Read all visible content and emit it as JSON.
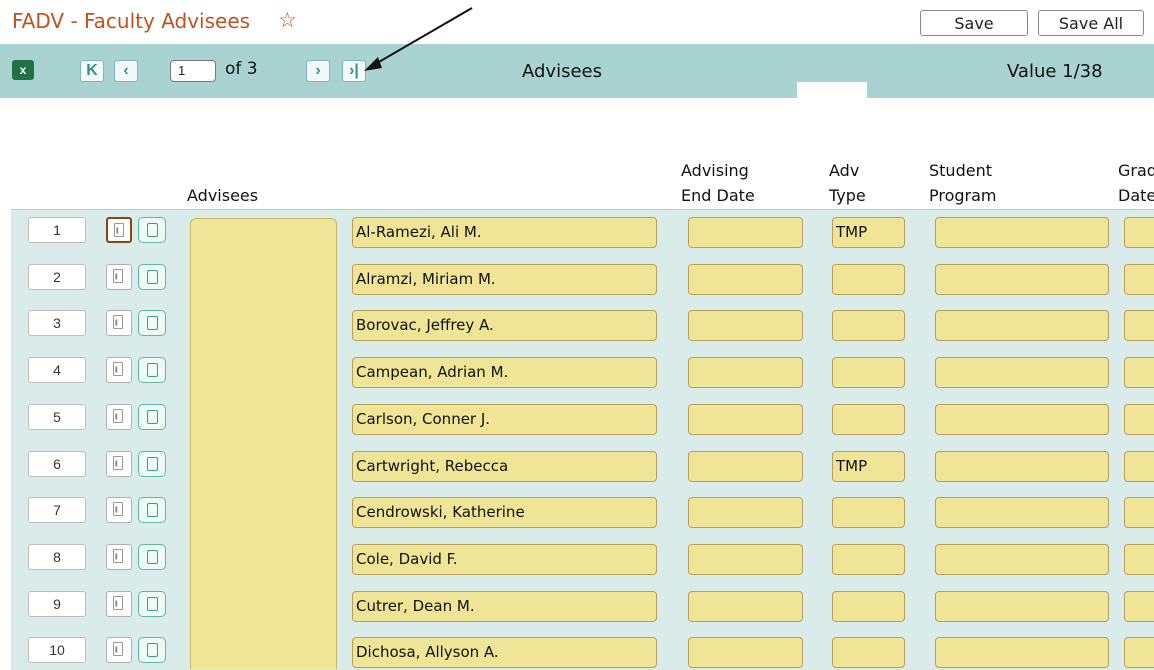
{
  "title": "FADV - Faculty Advisees",
  "buttons": {
    "save": "Save",
    "save_all": "Save All"
  },
  "nav": {
    "page_value": "1",
    "of_pages": "of 3",
    "heading": "Advisees",
    "value_counter": "Value 1/38"
  },
  "columns": {
    "advisees": "Advisees",
    "end_date_1": "Advising",
    "end_date_2": "End Date",
    "adv_type_1": "Adv",
    "adv_type_2": "Type",
    "program_1": "Student",
    "program_2": "Program",
    "grad_1": "Grad",
    "grad_2": "Date"
  },
  "rows": [
    {
      "num": "1",
      "name": "Al-Ramezi, Ali M.",
      "adv_type": "TMP"
    },
    {
      "num": "2",
      "name": "Alramzi, Miriam M.",
      "adv_type": ""
    },
    {
      "num": "3",
      "name": "Borovac, Jeffrey A.",
      "adv_type": ""
    },
    {
      "num": "4",
      "name": "Campean, Adrian M.",
      "adv_type": ""
    },
    {
      "num": "5",
      "name": "Carlson, Conner J.",
      "adv_type": ""
    },
    {
      "num": "6",
      "name": "Cartwright, Rebecca",
      "adv_type": "TMP"
    },
    {
      "num": "7",
      "name": "Cendrowski, Katherine",
      "adv_type": ""
    },
    {
      "num": "8",
      "name": "Cole, David F.",
      "adv_type": ""
    },
    {
      "num": "9",
      "name": "Cutrer, Dean M.",
      "adv_type": ""
    },
    {
      "num": "10",
      "name": "Dichosa, Allyson A.",
      "adv_type": ""
    }
  ],
  "icons": {
    "favorite": "star-outline-icon",
    "export": "excel-icon",
    "first": "first-page-icon",
    "prev": "previous-page-icon",
    "next": "next-page-icon",
    "last": "last-page-icon",
    "detail": "detail-icon",
    "document": "document-icon"
  },
  "colors": {
    "title": "#c0521f",
    "navbar": "#a9d3d1",
    "field": "#f0e596",
    "grid_bg": "#d9ecea"
  }
}
